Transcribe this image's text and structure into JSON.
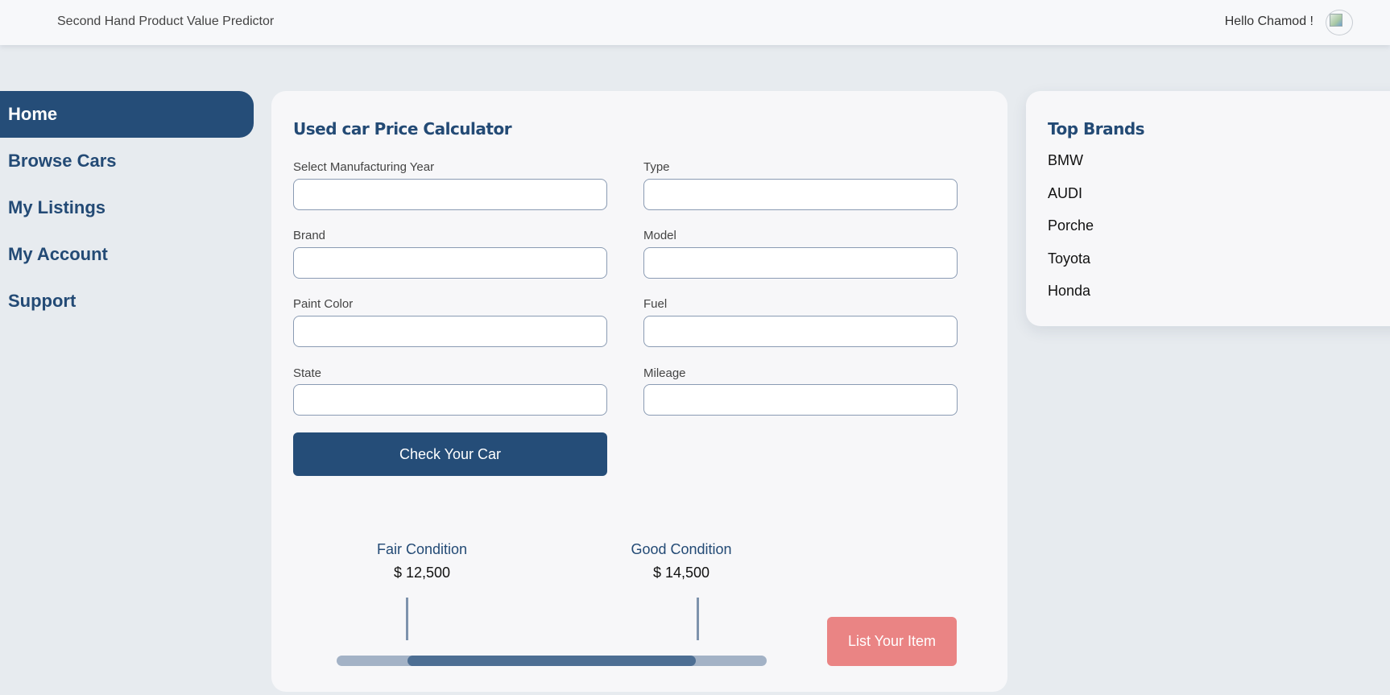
{
  "header": {
    "app_title": "Second Hand Product Value Predictor",
    "greeting": "Hello Chamod !"
  },
  "nav": {
    "items": [
      {
        "label": "Home",
        "active": true
      },
      {
        "label": "Browse Cars",
        "active": false
      },
      {
        "label": "My Listings",
        "active": false
      },
      {
        "label": "My Account",
        "active": false
      },
      {
        "label": "Support",
        "active": false
      }
    ]
  },
  "calculator": {
    "title": "Used car Price Calculator",
    "fields": {
      "year": {
        "label": "Select Manufacturing Year",
        "value": ""
      },
      "type": {
        "label": "Type",
        "value": ""
      },
      "brand": {
        "label": "Brand",
        "value": ""
      },
      "model": {
        "label": "Model",
        "value": ""
      },
      "paint_color": {
        "label": "Paint Color",
        "value": ""
      },
      "fuel": {
        "label": "Fuel",
        "value": ""
      },
      "state": {
        "label": "State",
        "value": ""
      },
      "mileage": {
        "label": "Mileage",
        "value": ""
      }
    },
    "check_button": "Check Your Car",
    "conditions": [
      {
        "label": "Fair Condition",
        "price": "$ 12,500"
      },
      {
        "label": "Good Condition",
        "price": "$ 14,500"
      }
    ],
    "range_fraction": {
      "start": 0.165,
      "end": 0.835
    },
    "list_button": "List Your Item"
  },
  "brands": {
    "title": "Top Brands",
    "items": [
      "BMW",
      "AUDI",
      "Porche",
      "Toyota",
      "Honda"
    ]
  }
}
